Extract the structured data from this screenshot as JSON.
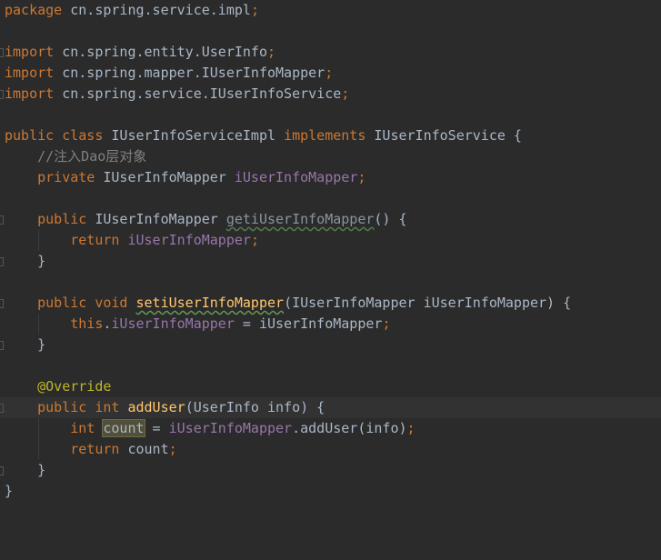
{
  "editor": {
    "language": "Java",
    "theme_colors": {
      "background": "#2b2b2b",
      "current_line": "#323232",
      "keyword": "#cc7832",
      "identifier": "#a9b7c6",
      "field": "#9876aa",
      "method_declaration": "#ffc66d",
      "comment": "#808080",
      "annotation": "#bbb529"
    },
    "lines": [
      {
        "tokens": [
          {
            "t": "package",
            "c": "kw"
          },
          {
            "t": " cn.spring.service.impl",
            "c": "plain"
          },
          {
            "t": ";",
            "c": "kw"
          }
        ]
      },
      {
        "tokens": []
      },
      {
        "fold": true,
        "tokens": [
          {
            "t": "import",
            "c": "kw"
          },
          {
            "t": " cn.spring.entity.UserInfo",
            "c": "plain"
          },
          {
            "t": ";",
            "c": "kw"
          }
        ]
      },
      {
        "tokens": [
          {
            "t": "import",
            "c": "kw"
          },
          {
            "t": " cn.spring.mapper.IUserInfoMapper",
            "c": "plain"
          },
          {
            "t": ";",
            "c": "kw"
          }
        ]
      },
      {
        "fold": true,
        "tokens": [
          {
            "t": "import",
            "c": "kw"
          },
          {
            "t": " cn.spring.service.IUserInfoService",
            "c": "plain"
          },
          {
            "t": ";",
            "c": "kw"
          }
        ]
      },
      {
        "tokens": []
      },
      {
        "tokens": [
          {
            "t": "public class ",
            "c": "kw"
          },
          {
            "t": "IUserInfoServiceImpl ",
            "c": "plain"
          },
          {
            "t": "implements ",
            "c": "kw"
          },
          {
            "t": "IUserInfoService {",
            "c": "plain"
          }
        ]
      },
      {
        "tokens": [
          {
            "t": "    //注入Dao层对象",
            "c": "cmt"
          }
        ]
      },
      {
        "tokens": [
          {
            "t": "    private ",
            "c": "kw"
          },
          {
            "t": "IUserInfoMapper ",
            "c": "plain"
          },
          {
            "t": "iUserInfoMapper",
            "c": "fld"
          },
          {
            "t": ";",
            "c": "kw"
          }
        ]
      },
      {
        "tokens": []
      },
      {
        "fold": true,
        "tokens": [
          {
            "t": "    public ",
            "c": "kw"
          },
          {
            "t": "IUserInfoMapper ",
            "c": "plain"
          },
          {
            "t": "getiUserInfoMapper",
            "c": "meth-dim squiggle"
          },
          {
            "t": "() {",
            "c": "plain"
          }
        ]
      },
      {
        "tokens": [
          {
            "t": "        return ",
            "c": "kw"
          },
          {
            "t": "iUserInfoMapper",
            "c": "fld"
          },
          {
            "t": ";",
            "c": "kw"
          }
        ]
      },
      {
        "fold": true,
        "tokens": [
          {
            "t": "    }",
            "c": "plain"
          }
        ]
      },
      {
        "tokens": []
      },
      {
        "fold": true,
        "tokens": [
          {
            "t": "    public void ",
            "c": "kw"
          },
          {
            "t": "setiUserInfoMapper",
            "c": "fn squiggle"
          },
          {
            "t": "(IUserInfoMapper iUserInfoMapper) {",
            "c": "plain"
          }
        ]
      },
      {
        "tokens": [
          {
            "t": "        this",
            "c": "kw"
          },
          {
            "t": ".",
            "c": "plain"
          },
          {
            "t": "iUserInfoMapper",
            "c": "fld"
          },
          {
            "t": " = iUserInfoMapper",
            "c": "plain"
          },
          {
            "t": ";",
            "c": "kw"
          }
        ]
      },
      {
        "fold": true,
        "tokens": [
          {
            "t": "    }",
            "c": "plain"
          }
        ]
      },
      {
        "tokens": []
      },
      {
        "tokens": [
          {
            "t": "    @Override",
            "c": "ann"
          }
        ]
      },
      {
        "current": true,
        "fold": true,
        "tokens": [
          {
            "t": "    public int ",
            "c": "kw"
          },
          {
            "t": "addUser",
            "c": "fn"
          },
          {
            "t": "(UserInfo info) {",
            "c": "plain"
          }
        ]
      },
      {
        "tokens": [
          {
            "t": "        int ",
            "c": "kw"
          },
          {
            "t": "count",
            "c": "plain hl-usage"
          },
          {
            "t": " = ",
            "c": "plain"
          },
          {
            "t": "iUserInfoMapper",
            "c": "fld"
          },
          {
            "t": ".addUser(info)",
            "c": "plain"
          },
          {
            "t": ";",
            "c": "kw"
          }
        ]
      },
      {
        "tokens": [
          {
            "t": "        return ",
            "c": "kw"
          },
          {
            "t": "count",
            "c": "plain"
          },
          {
            "t": ";",
            "c": "kw"
          }
        ]
      },
      {
        "fold": true,
        "tokens": [
          {
            "t": "    }",
            "c": "plain"
          }
        ]
      },
      {
        "tokens": [
          {
            "t": "}",
            "c": "plain"
          }
        ]
      }
    ]
  }
}
